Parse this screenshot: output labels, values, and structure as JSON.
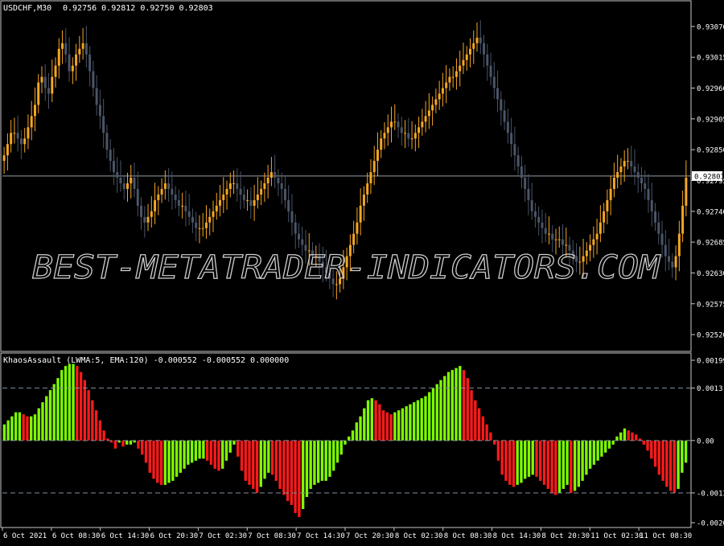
{
  "header": {
    "symbol": "USDCHF,M30",
    "ohlc": "0.92756 0.92812 0.92750 0.92803"
  },
  "indicator": {
    "label": "KhaosAssault (LWMA:5, EMA:120) -0.000552 -0.000552 0.000000"
  },
  "watermark": "BEST-METATRADER-INDICATORS.COM",
  "colors": {
    "background": "#000000",
    "bull": "#f5a623",
    "bear": "#4a5568",
    "hist_up": "#7fff00",
    "hist_down": "#ff1a1a",
    "text": "#ffffff",
    "grid": "#c8c8c8"
  },
  "chart_data": [
    {
      "type": "candlestick",
      "x_labels": [
        "6 Oct 2021",
        "6 Oct 08:30",
        "6 Oct 14:30",
        "6 Oct 20:30",
        "7 Oct 02:30",
        "7 Oct 08:30",
        "7 Oct 14:30",
        "7 Oct 20:30",
        "8 Oct 02:30",
        "8 Oct 08:30",
        "8 Oct 14:30",
        "8 Oct 20:30",
        "11 Oct 02:30",
        "11 Oct 08:30"
      ],
      "y_ticks": [
        "0.93070",
        "0.93015",
        "0.92960",
        "0.92905",
        "0.92850",
        "0.92795",
        "0.92740",
        "0.92685",
        "0.92630",
        "0.92575",
        "0.92520"
      ],
      "ylim": [
        0.925,
        0.931
      ],
      "current_price": "0.92803",
      "close": [
        0.9284,
        0.9286,
        0.9288,
        0.9288,
        0.9287,
        0.9286,
        0.9287,
        0.9289,
        0.9291,
        0.9293,
        0.9297,
        0.9298,
        0.9296,
        0.9295,
        0.9298,
        0.93,
        0.9303,
        0.9304,
        0.9302,
        0.9299,
        0.93,
        0.9302,
        0.9303,
        0.9304,
        0.9302,
        0.9299,
        0.9296,
        0.9293,
        0.9291,
        0.9288,
        0.9285,
        0.9283,
        0.9281,
        0.928,
        0.9279,
        0.9278,
        0.9279,
        0.928,
        0.9278,
        0.9275,
        0.9273,
        0.9272,
        0.9273,
        0.9274,
        0.9276,
        0.9277,
        0.9278,
        0.9279,
        0.9278,
        0.9277,
        0.9276,
        0.9275,
        0.9275,
        0.9274,
        0.9273,
        0.9272,
        0.9271,
        0.9271,
        0.9271,
        0.9272,
        0.9273,
        0.9274,
        0.9275,
        0.9276,
        0.9277,
        0.9278,
        0.9279,
        0.9279,
        0.9278,
        0.9277,
        0.9276,
        0.9276,
        0.9275,
        0.9276,
        0.9277,
        0.9278,
        0.9279,
        0.928,
        0.9281,
        0.928,
        0.9279,
        0.9278,
        0.9276,
        0.9274,
        0.9272,
        0.927,
        0.9269,
        0.9268,
        0.9267,
        0.9267,
        0.9266,
        0.9266,
        0.9265,
        0.9264,
        0.9263,
        0.9262,
        0.9261,
        0.9261,
        0.9262,
        0.9264,
        0.9266,
        0.9268,
        0.927,
        0.9272,
        0.9275,
        0.9277,
        0.9279,
        0.9281,
        0.9283,
        0.9285,
        0.9287,
        0.9288,
        0.9289,
        0.929,
        0.929,
        0.9289,
        0.9288,
        0.9288,
        0.9287,
        0.9287,
        0.9288,
        0.9289,
        0.929,
        0.9291,
        0.9292,
        0.9293,
        0.9294,
        0.9295,
        0.9296,
        0.9297,
        0.9298,
        0.9298,
        0.9299,
        0.93,
        0.9301,
        0.9302,
        0.9303,
        0.9304,
        0.9305,
        0.9304,
        0.9302,
        0.93,
        0.9298,
        0.9296,
        0.9294,
        0.9292,
        0.929,
        0.9288,
        0.9286,
        0.9284,
        0.9282,
        0.928,
        0.9278,
        0.9276,
        0.9274,
        0.9273,
        0.9272,
        0.9271,
        0.927,
        0.927,
        0.9269,
        0.9269,
        0.9269,
        0.9268,
        0.9268,
        0.9267,
        0.9266,
        0.9265,
        0.9265,
        0.9266,
        0.9267,
        0.9268,
        0.9269,
        0.927,
        0.9272,
        0.9274,
        0.9276,
        0.9278,
        0.928,
        0.9281,
        0.9282,
        0.9283,
        0.9283,
        0.9282,
        0.9281,
        0.928,
        0.9279,
        0.9278,
        0.9276,
        0.9274,
        0.9272,
        0.927,
        0.9268,
        0.9266,
        0.9265,
        0.9264,
        0.9266,
        0.927,
        0.9275,
        0.928
      ],
      "hist": [
        0.0004,
        0.0005,
        0.0006,
        0.0007,
        0.0007,
        0.00065,
        0.0006,
        0.0006,
        0.00065,
        0.0008,
        0.00095,
        0.0011,
        0.00125,
        0.0014,
        0.00155,
        0.00175,
        0.00185,
        0.0019,
        0.0019,
        0.00185,
        0.0017,
        0.0015,
        0.00125,
        0.001,
        0.00075,
        0.0005,
        0.00025,
        5e-05,
        -5e-05,
        -0.0002,
        -5e-05,
        -0.00015,
        -0.0001,
        -0.0001,
        -5e-05,
        -0.0002,
        -0.00035,
        -0.00055,
        -0.0008,
        -0.00095,
        -0.00105,
        -0.0011,
        -0.0011,
        -0.00105,
        -0.001,
        -0.0009,
        -0.0008,
        -0.0007,
        -0.0006,
        -0.00055,
        -0.0005,
        -0.00045,
        -0.00045,
        -0.0005,
        -0.0006,
        -0.0007,
        -0.00075,
        -0.0007,
        -0.0005,
        -0.0003,
        -0.0001,
        -0.0004,
        -0.00075,
        -0.001,
        -0.0011,
        -0.0012,
        -0.0013,
        -0.00115,
        -0.00095,
        -0.0008,
        -0.00085,
        -0.001,
        -0.0012,
        -0.00135,
        -0.0015,
        -0.0016,
        -0.0018,
        -0.0019,
        -0.0017,
        -0.0014,
        -0.0012,
        -0.0011,
        -0.00105,
        -0.001,
        -0.001,
        -0.0009,
        -0.00075,
        -0.00055,
        -0.00035,
        -0.0001,
        0.0001,
        0.00025,
        0.00045,
        0.0006,
        0.0008,
        0.001,
        0.00105,
        0.001,
        0.0009,
        0.00075,
        0.0007,
        0.00065,
        0.0007,
        0.00075,
        0.0008,
        0.00085,
        0.0009,
        0.00095,
        0.001,
        0.00105,
        0.0011,
        0.0012,
        0.0013,
        0.0014,
        0.0015,
        0.0016,
        0.0017,
        0.00175,
        0.0018,
        0.00185,
        0.00175,
        0.00155,
        0.00125,
        0.001,
        0.0008,
        0.0006,
        0.0004,
        0.0002,
        -0.0001,
        -0.0005,
        -0.00085,
        -0.001,
        -0.0011,
        -0.00115,
        -0.0011,
        -0.00105,
        -0.00095,
        -0.0009,
        -0.00085,
        -0.0009,
        -0.001,
        -0.0011,
        -0.0012,
        -0.0013,
        -0.00135,
        -0.0013,
        -0.0012,
        -0.0011,
        -0.0013,
        -0.00125,
        -0.00115,
        -0.001,
        -0.00085,
        -0.0007,
        -0.0006,
        -0.0005,
        -0.0004,
        -0.0003,
        -0.0002,
        -0.0001,
        0.0001,
        0.0002,
        0.0003,
        0.00025,
        0.0002,
        0.00015,
        5e-05,
        -0.0001,
        -0.00025,
        -0.00045,
        -0.00065,
        -0.00085,
        -0.001,
        -0.00115,
        -0.00125,
        -0.0013,
        -0.0012,
        -0.0008,
        -0.00055
      ]
    },
    {
      "type": "bar",
      "title": "KhaosAssault (LWMA:5, EMA:120)",
      "y_ticks": [
        "0.001992",
        "0.0013",
        "0.00",
        "-0.0013",
        "-0.002039"
      ],
      "ylim": [
        -0.002039,
        0.001992
      ],
      "levels": [
        0.0013,
        0.0,
        -0.0013
      ]
    }
  ]
}
